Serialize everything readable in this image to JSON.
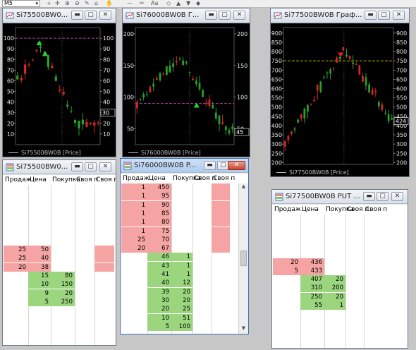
{
  "toolbar": {
    "timeframe": "M5",
    "font_label": "Aa"
  },
  "windows": {
    "chart1": {
      "title": "Si75500BW0..."
    },
    "chart2": {
      "title": "Si76000BW0B Г..."
    },
    "chart3": {
      "title": "Si77500BW0B Граф..."
    },
    "dom1": {
      "title": "Si75500BW0..."
    },
    "dom2": {
      "title": "Si76000BW0B P..."
    },
    "dom3": {
      "title": "Si77500BW0B PUT ..."
    }
  },
  "charts": [
    {
      "legend": "Si75500BW0B [Price]",
      "ylim": [
        0,
        110
      ],
      "ticks": [
        10,
        20,
        30,
        40,
        50,
        60,
        70,
        80,
        90,
        100
      ],
      "tick_labels": [
        "10",
        "20",
        "30",
        "40",
        "50",
        "60",
        "70",
        "80",
        "90",
        "100"
      ],
      "last": "30",
      "hline": 100,
      "hline_color": "#b23cb2",
      "arrows": [
        {
          "dir": "up",
          "x": 0.28,
          "y": 96
        },
        {
          "dir": "up",
          "x": 0.35,
          "y": 86
        }
      ]
    },
    {
      "legend": "Si76000BW0B [Price]",
      "ylim": [
        25,
        210
      ],
      "ticks": [
        50,
        100,
        150,
        200
      ],
      "tick_labels": [
        "50",
        "100",
        "150",
        "200"
      ],
      "last": "45",
      "hline": 90,
      "hline_color": "#b23cb2",
      "arrows": [
        {
          "dir": "up",
          "x": 0.62,
          "y": 88
        }
      ]
    },
    {
      "legend": "Si77500BW0B [Price]",
      "ylim": [
        190,
        930
      ],
      "ticks": [
        200,
        250,
        300,
        350,
        400,
        450,
        500,
        550,
        600,
        650,
        700,
        750,
        800,
        850,
        900
      ],
      "tick_labels": [
        "200",
        "250",
        "300",
        "350",
        "400",
        "450",
        "500",
        "550",
        "600",
        "650",
        "700",
        "750",
        "800",
        "850",
        "900"
      ],
      "last": "424",
      "hline": 750,
      "hline_color": "#c9b400",
      "arrows": [
        {
          "dir": "down",
          "x": 0.52,
          "y": 780
        }
      ]
    }
  ],
  "dom_headers": {
    "sell": "Продаж",
    "price": "Цена",
    "buy": "Покупка",
    "own1": "Своя п",
    "own2": "Своя п"
  },
  "dom1_rows": [
    {
      "sell": "25",
      "price": "50",
      "buy": "",
      "side": "ask"
    },
    {
      "sell": "25",
      "price": "40",
      "buy": "",
      "side": "ask"
    },
    {
      "sell": "20",
      "price": "38",
      "buy": "",
      "side": "ask"
    },
    {
      "sell": "",
      "price": "15",
      "buy": "80",
      "side": "bid"
    },
    {
      "sell": "",
      "price": "10",
      "buy": "150",
      "side": "bid"
    },
    {
      "sell": "",
      "price": "9",
      "buy": "20",
      "side": "bid"
    },
    {
      "sell": "",
      "price": "5",
      "buy": "250",
      "side": "bid"
    }
  ],
  "dom2_rows": [
    {
      "sell": "1",
      "price": "450",
      "buy": "",
      "side": "ask"
    },
    {
      "sell": "1",
      "price": "95",
      "buy": "",
      "side": "ask"
    },
    {
      "sell": "1",
      "price": "90",
      "buy": "",
      "side": "ask"
    },
    {
      "sell": "1",
      "price": "85",
      "buy": "",
      "side": "ask"
    },
    {
      "sell": "1",
      "price": "80",
      "buy": "",
      "side": "ask"
    },
    {
      "sell": "1",
      "price": "75",
      "buy": "",
      "side": "ask"
    },
    {
      "sell": "25",
      "price": "70",
      "buy": "",
      "side": "ask"
    },
    {
      "sell": "20",
      "price": "67",
      "buy": "",
      "side": "ask"
    },
    {
      "sell": "",
      "price": "46",
      "buy": "1",
      "side": "bid"
    },
    {
      "sell": "",
      "price": "43",
      "buy": "1",
      "side": "bid"
    },
    {
      "sell": "",
      "price": "41",
      "buy": "1",
      "side": "bid"
    },
    {
      "sell": "",
      "price": "40",
      "buy": "12",
      "side": "bid"
    },
    {
      "sell": "",
      "price": "39",
      "buy": "20",
      "side": "bid"
    },
    {
      "sell": "",
      "price": "30",
      "buy": "20",
      "side": "bid"
    },
    {
      "sell": "",
      "price": "20",
      "buy": "25",
      "side": "bid"
    },
    {
      "sell": "",
      "price": "10",
      "buy": "51",
      "side": "bid"
    },
    {
      "sell": "",
      "price": "5",
      "buy": "100",
      "side": "bid"
    }
  ],
  "dom3_rows": [
    {
      "sell": "20",
      "price": "436",
      "buy": "",
      "side": "ask"
    },
    {
      "sell": "5",
      "price": "433",
      "buy": "",
      "side": "ask"
    },
    {
      "sell": "",
      "price": "407",
      "buy": "20",
      "side": "bid"
    },
    {
      "sell": "",
      "price": "310",
      "buy": "200",
      "side": "bid"
    },
    {
      "sell": "",
      "price": "250",
      "buy": "20",
      "side": "bid"
    },
    {
      "sell": "",
      "price": "55",
      "buy": "1",
      "side": "bid"
    }
  ]
}
